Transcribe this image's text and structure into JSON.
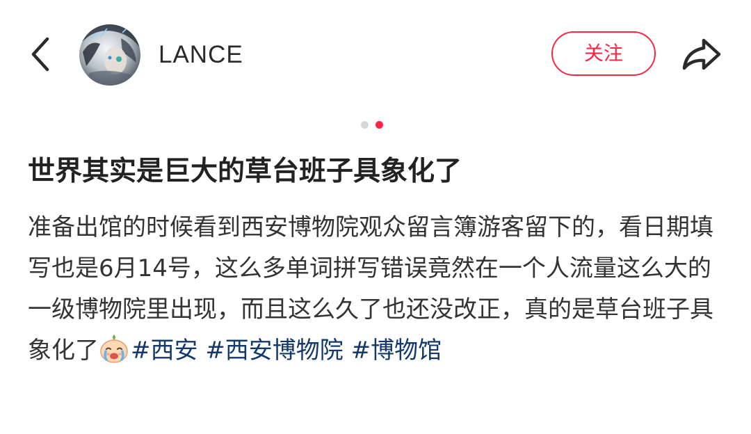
{
  "header": {
    "username": "LANCE",
    "follow_label": "关注"
  },
  "icons": {
    "back": "chevron-left-icon",
    "share": "share-arrow-icon",
    "avatar": "user-avatar",
    "emoji": "crying-face-emoji"
  },
  "carousel": {
    "total": 2,
    "active_index": 1
  },
  "post": {
    "title": "世界其实是巨大的草台班子具象化了",
    "body": "准备出馆的时候看到西安博物院观众留言簿游客留下的，看日期填写也是6月14号，这么多单词拼写错误竟然在一个人流量这么大的一级博物院里出现，而且这么久了也还没改正，真的是草台班子具象化了",
    "tags": [
      "#西安",
      "#西安博物院",
      "#博物馆"
    ]
  },
  "colors": {
    "accent": "#ff2442",
    "hashtag": "#13386c",
    "dot_inactive": "#d8d8d8",
    "dot_active": "#ff2442",
    "text": "#333333"
  }
}
